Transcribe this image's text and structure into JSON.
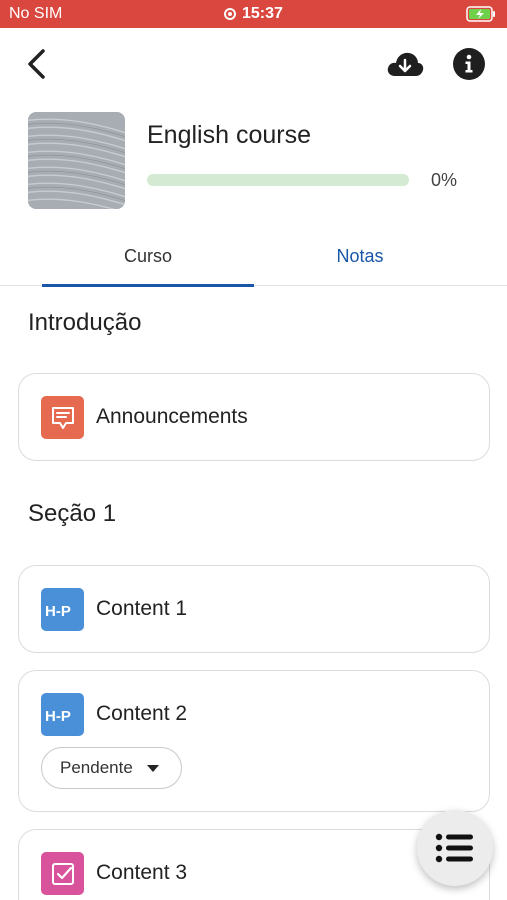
{
  "status_bar": {
    "carrier": "No SIM",
    "time": "15:37",
    "battery_icon": "battery-charging-icon",
    "recording_icon": "screen-recording-icon"
  },
  "header": {
    "back_icon": "chevron-left-icon",
    "download_icon": "cloud-download-icon",
    "info_icon": "info-icon"
  },
  "course": {
    "title": "English course",
    "progress_percent": 0,
    "progress_label": "0%",
    "colors": {
      "progress_track": "#d4ead3",
      "accent": "#1a56a8"
    }
  },
  "tabs": [
    {
      "label": "Curso",
      "active": true
    },
    {
      "label": "Notas",
      "active": false
    }
  ],
  "sections": [
    {
      "title": "Introdução",
      "modules": [
        {
          "name": "Announcements",
          "icon": "forum-icon",
          "color": "#e66a4f"
        }
      ]
    },
    {
      "title": "Seção 1",
      "modules": [
        {
          "name": "Content 1",
          "icon": "h5p-icon",
          "color": "#4a90d9"
        },
        {
          "name": "Content 2",
          "icon": "h5p-icon",
          "color": "#4a90d9",
          "completion": "Pendente"
        },
        {
          "name": "Content 3",
          "icon": "assignment-icon",
          "color": "#d9539c"
        }
      ]
    }
  ],
  "fab": {
    "icon": "course-index-list-icon"
  }
}
